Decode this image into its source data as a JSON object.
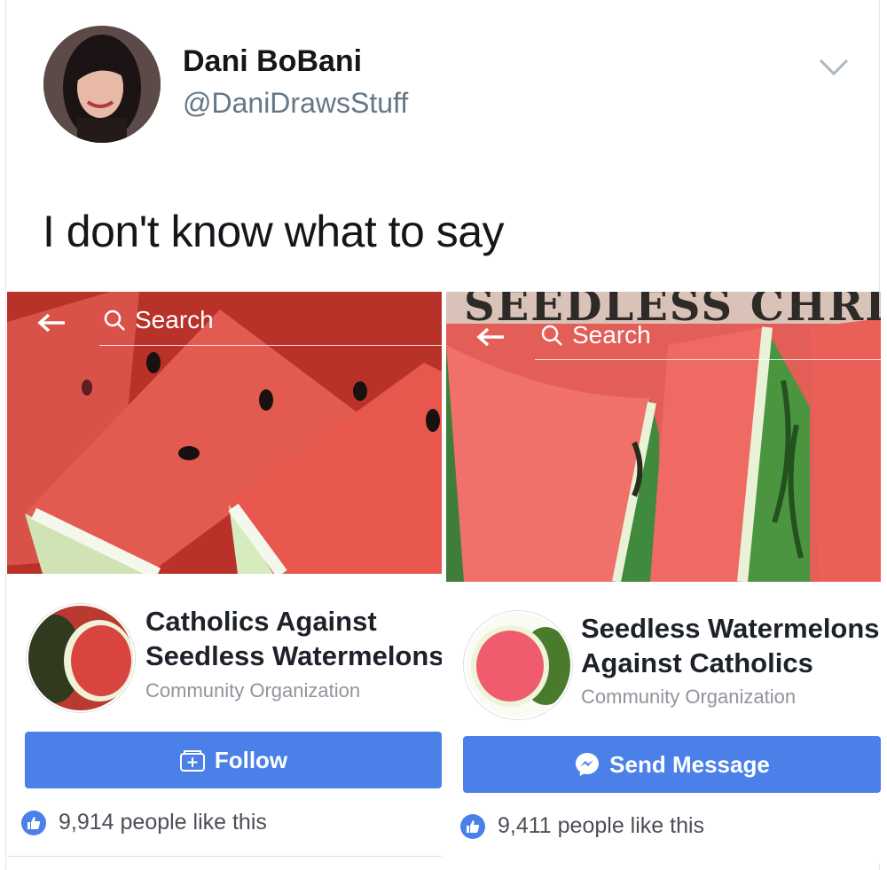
{
  "tweet": {
    "author_name": "Dani BoBani",
    "author_handle": "@DaniDrawsStuff",
    "text": "I don't know what to say"
  },
  "left_page": {
    "search_placeholder": "Search",
    "name_line1": "Catholics Against",
    "name_line2": "Seedless Watermelons",
    "category": "Community Organization",
    "button_label": "Follow",
    "likes_text": "9,914 people like this"
  },
  "right_page": {
    "banner_text": "SEEDLESS CHRISTI",
    "search_placeholder": "Search",
    "name_line1": "Seedless Watermelons",
    "name_line2": "Against Catholics",
    "category": "Community Organization",
    "button_label": "Send Message",
    "likes_text": "9,411 people like this"
  },
  "colors": {
    "facebook_blue": "#4a80e8",
    "twitter_gray": "#657786"
  },
  "icons": [
    "chevron-down-icon",
    "back-arrow-icon",
    "search-icon",
    "follow-icon",
    "messenger-icon",
    "like-icon"
  ]
}
